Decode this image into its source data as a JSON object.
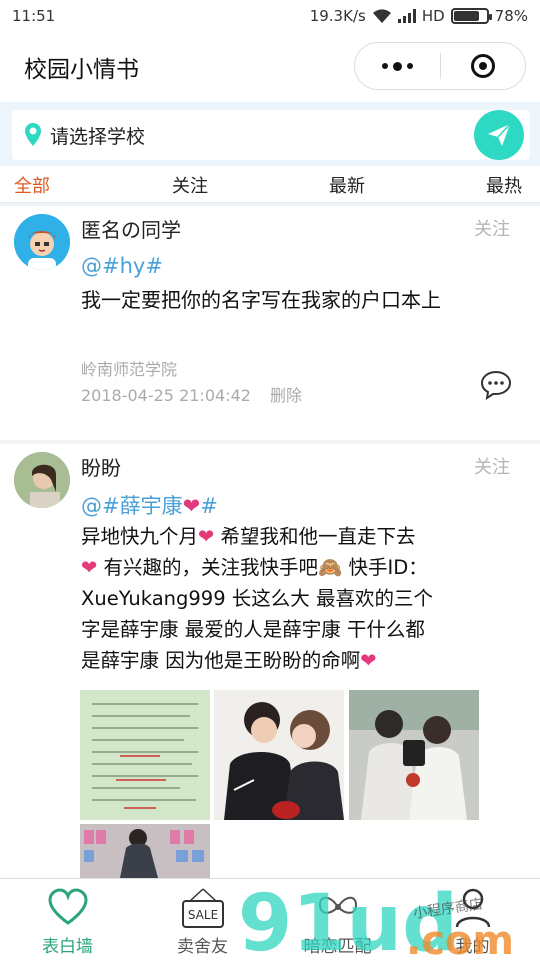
{
  "status_bar": {
    "time": "11:51",
    "network_speed": "19.3K/s",
    "network_type": "HD",
    "battery": "78%",
    "battery_level": 0.78
  },
  "nav": {
    "title": "校园小情书"
  },
  "search": {
    "placeholder": "请选择学校"
  },
  "tabs": [
    {
      "label": "全部",
      "active": true
    },
    {
      "label": "关注",
      "active": false
    },
    {
      "label": "最新",
      "active": false
    },
    {
      "label": "最热",
      "active": false
    }
  ],
  "posts": [
    {
      "author": "匿名の同学",
      "follow_label": "关注",
      "tag": "@#hy#",
      "content": "我一定要把你的名字写在我家的户口本上",
      "school": "岭南师范学院",
      "timestamp": "2018-04-25 21:04:42",
      "delete_label": "删除"
    },
    {
      "author": "盼盼",
      "author_suffix": "",
      "follow_label": "关注",
      "tag_prefix": "@#薛宇康",
      "tag_suffix": "#",
      "content_line1": "异地快九个月",
      "content_line1b": " 希望我和他一直走下去",
      "content_line2": " 有兴趣的，关注我快手吧",
      "content_line2b": " 快手ID：",
      "content_line3": "XueYukang999 长这么大 最喜欢的三个",
      "content_line4": "字是薛宇康 最爱的人是薛宇康 干什么都",
      "content_line5": "是薛宇康 因为他是王盼盼的命啊",
      "heart": "❤",
      "monkey": "🙈"
    }
  ],
  "tabbar": [
    {
      "label": "表白墙",
      "active": true
    },
    {
      "label": "卖舍友",
      "active": false,
      "sign_text": "SALE"
    },
    {
      "label": "暗恋匹配",
      "active": false
    },
    {
      "label": "我的",
      "active": false
    }
  ],
  "watermark": {
    "brand": "91ud",
    "domain": ".com",
    "handwriting": "小程序商店"
  },
  "colors": {
    "accent": "#e05a24",
    "send_button": "#2ed9c3",
    "tag": "#4aa0d8",
    "tab_active": "#2aa57a",
    "heart": "#e23a7a"
  }
}
